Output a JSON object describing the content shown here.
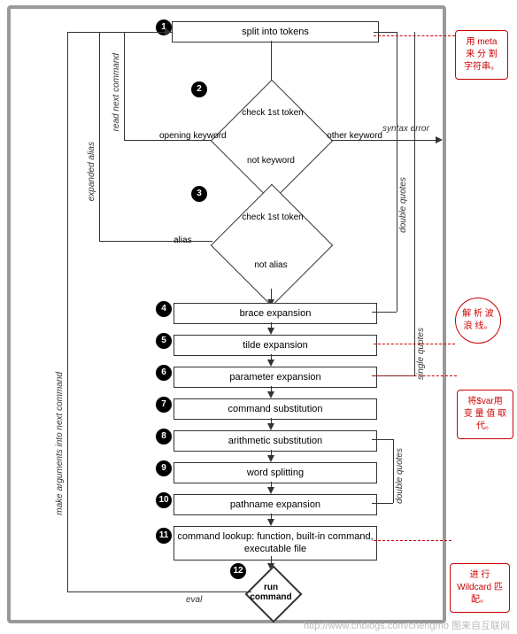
{
  "chart_data": {
    "type": "flowchart",
    "nodes": [
      {
        "id": 1,
        "label": "split into tokens",
        "shape": "box"
      },
      {
        "id": 2,
        "label_top": "check 1st token",
        "label_left": "opening keyword",
        "label_right": "other keyword",
        "label_bottom": "not keyword",
        "shape": "diamond"
      },
      {
        "id": 3,
        "label_top": "check 1st token",
        "label_left": "alias",
        "label_bottom": "not alias",
        "shape": "diamond"
      },
      {
        "id": 4,
        "label": "brace expansion",
        "shape": "box"
      },
      {
        "id": 5,
        "label": "tilde expansion",
        "shape": "box"
      },
      {
        "id": 6,
        "label": "parameter expansion",
        "shape": "box"
      },
      {
        "id": 7,
        "label": "command substitution",
        "shape": "box"
      },
      {
        "id": 8,
        "label": "arithmetic substitution",
        "shape": "box"
      },
      {
        "id": 9,
        "label": "word splitting",
        "shape": "box"
      },
      {
        "id": 10,
        "label": "pathname expansion",
        "shape": "box"
      },
      {
        "id": 11,
        "label": "command lookup: function, built-in command, executable file",
        "shape": "box"
      },
      {
        "id": 12,
        "label": "run command",
        "shape": "diamond-bold"
      }
    ],
    "edge_labels": {
      "syntax_error": "syntax error",
      "double_quotes": "double quotes",
      "single_quotes": "single quotes",
      "read_next": "read next command",
      "expanded_alias": "expanded alias",
      "make_args": "make arguments into next command",
      "eval": "eval"
    },
    "callouts": [
      {
        "id": "c1",
        "text": "用 meta 来 分 割 字符串。"
      },
      {
        "id": "c2",
        "text": "解 析 波 浪 线。"
      },
      {
        "id": "c3",
        "text": "将$var用 变 量 值 取代。"
      },
      {
        "id": "c4",
        "text": "进 行 Wildcard 匹配。"
      }
    ]
  },
  "watermark": "http://www.cnblogs.com/chengmo  图来自互联网"
}
